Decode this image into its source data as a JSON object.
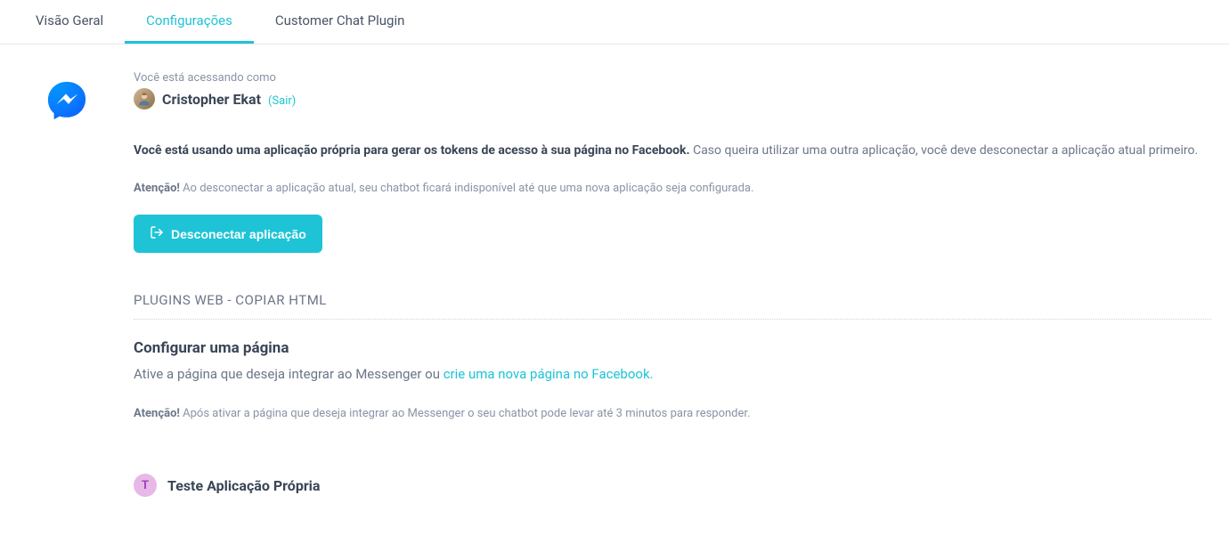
{
  "tabs": [
    {
      "label": "Visão Geral"
    },
    {
      "label": "Configurações"
    },
    {
      "label": "Customer Chat Plugin"
    }
  ],
  "accessing_as_label": "Você está acessando como",
  "user": {
    "name": "Cristopher Ekat",
    "logout_label": "Sair"
  },
  "info_bold": "Você está usando uma aplicação própria para gerar os tokens de acesso à sua página no Facebook.",
  "info_rest": " Caso queira utilizar uma outra aplicação, você deve desconectar a aplicação atual primeiro.",
  "warning_label": "Atenção!",
  "warning_text": " Ao desconectar a aplicação atual, seu chatbot ficará indisponível até que uma nova aplicação seja configurada.",
  "disconnect_btn": "Desconectar aplicação",
  "section_title": "PLUGINS WEB - COPIAR HTML",
  "config_title": "Configurar uma página",
  "config_desc_prefix": "Ative a página que deseja integrar ao Messenger ou ",
  "config_desc_link": "crie uma nova página no Facebook.",
  "warning2_label": "Atenção!",
  "warning2_text": " Após ativar a página que deseja integrar ao Messenger o seu chatbot pode levar até 3 minutos para responder.",
  "app": {
    "badge_letter": "T",
    "name": "Teste Aplicação Própria"
  }
}
